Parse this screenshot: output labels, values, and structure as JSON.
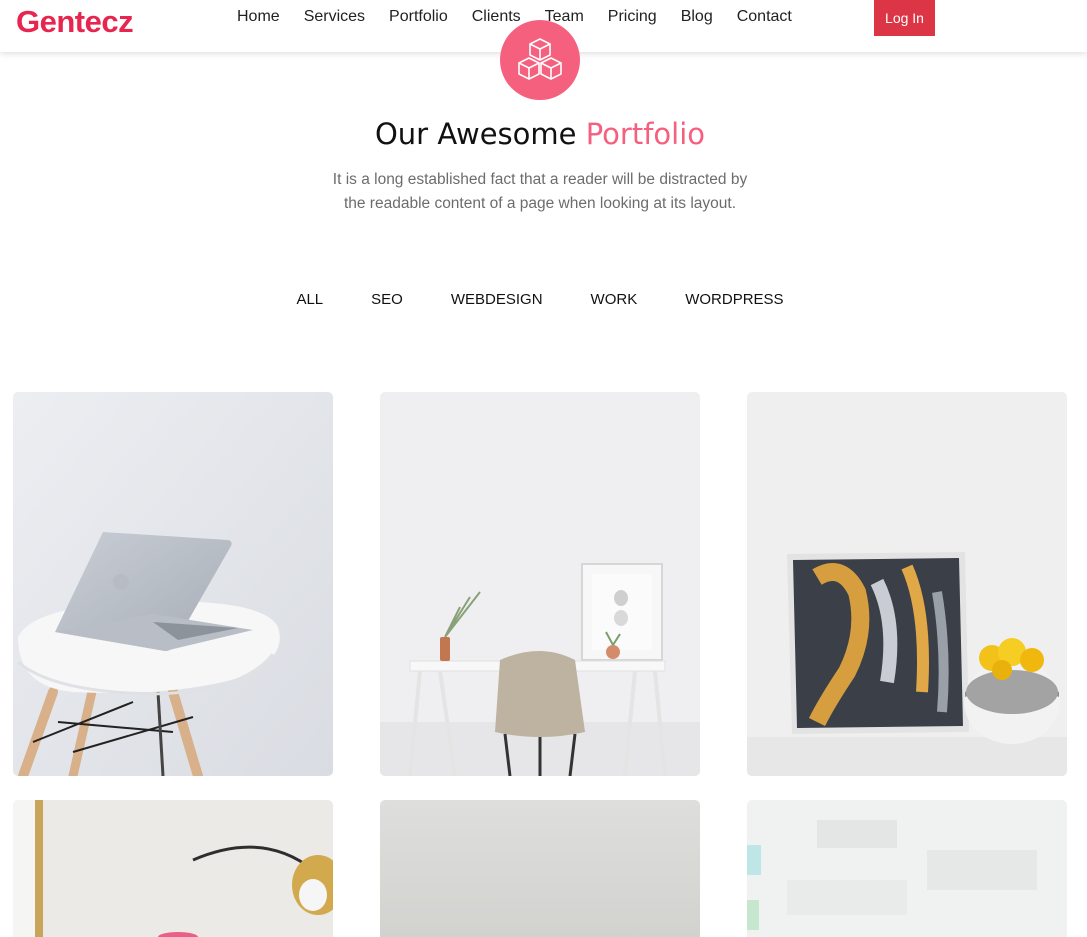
{
  "brand": {
    "logo_text": "Gentecz",
    "accent_color": "#f5607f",
    "logo_color": "#e8254f",
    "button_color": "#dc3545"
  },
  "nav": {
    "items": [
      "Home",
      "Services",
      "Portfolio",
      "Clients",
      "Team",
      "Pricing",
      "Blog",
      "Contact"
    ],
    "login_label": "Log In"
  },
  "section": {
    "icon": "cubes-icon",
    "title_main": "Our Awesome",
    "title_accent": "Portfolio",
    "description": "It is a long established fact that a reader will be distracted by the readable content of a page when looking at its layout."
  },
  "filters": [
    "ALL",
    "SEO",
    "WEBDESIGN",
    "WORK",
    "WORDPRESS"
  ],
  "portfolio": {
    "items": [
      {
        "image": "laptop-on-white-chair-photo"
      },
      {
        "image": "white-desk-with-chair-photo"
      },
      {
        "image": "abstract-painting-and-flower-pot-photo"
      },
      {
        "image": "brass-lamp-and-frame-photo"
      },
      {
        "image": "plain-grey-wall-photo"
      },
      {
        "image": "blurred-whiteboard-photo"
      }
    ]
  }
}
